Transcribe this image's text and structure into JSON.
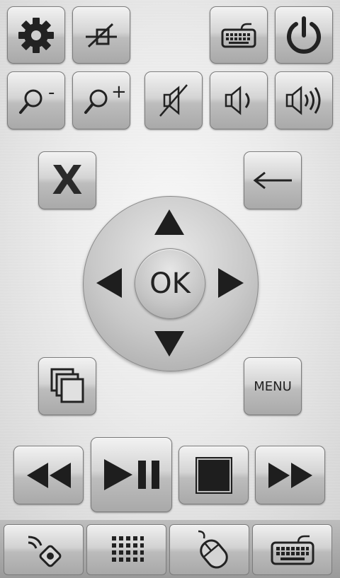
{
  "top_row": {
    "settings": "gear-icon",
    "disconnect": "network-disconnected-icon",
    "keyboard": "keyboard-icon",
    "power": "power-icon"
  },
  "volume_row": {
    "zoom_out": "-",
    "zoom_in": "+",
    "mute": "mute-icon",
    "volume_down": "volume-low-icon",
    "volume_up": "volume-high-icon"
  },
  "controls": {
    "close_label": "X",
    "back_icon": "back-arrow-icon",
    "ok_label": "OK",
    "menu_label": "MENU",
    "windows_icon": "windows-icon"
  },
  "media": {
    "rewind": "rewind-icon",
    "play_pause": "play-pause-icon",
    "stop": "stop-icon",
    "fast_forward": "fast-forward-icon"
  },
  "bottom_tabs": [
    "remote-icon",
    "numpad-icon",
    "mouse-icon",
    "keyboard-icon"
  ]
}
